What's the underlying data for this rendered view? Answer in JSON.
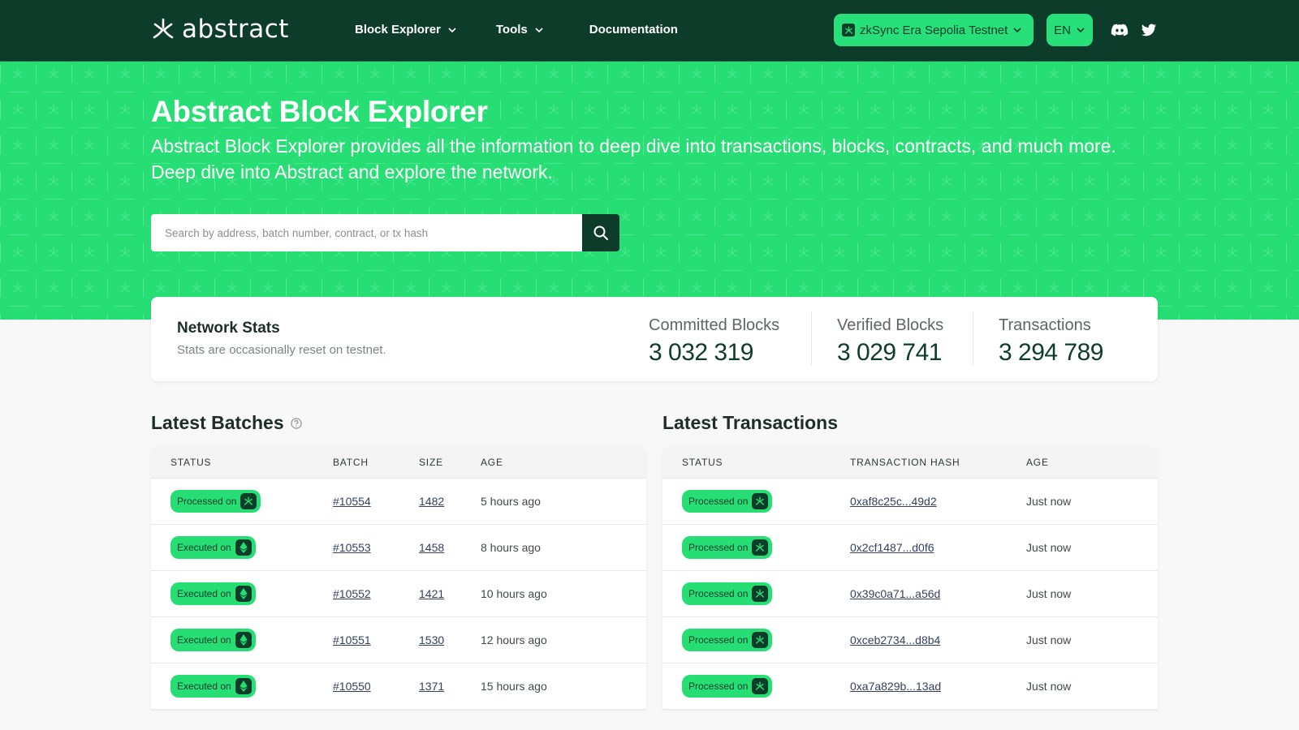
{
  "header": {
    "logo_text": "abstract",
    "nav": [
      {
        "label": "Block Explorer",
        "has_dropdown": true
      },
      {
        "label": "Tools",
        "has_dropdown": true
      },
      {
        "label": "Documentation",
        "has_dropdown": false
      }
    ],
    "network_selector": "zkSync Era Sepolia Testnet",
    "language_selector": "EN",
    "social_icons": [
      "discord-icon",
      "twitter-icon"
    ]
  },
  "hero": {
    "title": "Abstract Block Explorer",
    "description": "Abstract Block Explorer provides all the information to deep dive into transactions, blocks, contracts, and much more. Deep dive into Abstract and explore the network.",
    "search": {
      "placeholder": "Search by address, batch number, contract, or tx hash",
      "value": ""
    }
  },
  "stats": {
    "title": "Network Stats",
    "subtitle": "Stats are occasionally reset on testnet.",
    "items": [
      {
        "label": "Committed Blocks",
        "value": "3 032 319"
      },
      {
        "label": "Verified Blocks",
        "value": "3 029 741"
      },
      {
        "label": "Transactions",
        "value": "3 294 789"
      }
    ]
  },
  "batches": {
    "title": "Latest Batches",
    "columns": [
      "STATUS",
      "BATCH",
      "SIZE",
      "AGE"
    ],
    "rows": [
      {
        "status": "Processed on",
        "network": "abstract",
        "batch": "#10554",
        "size": "1482",
        "age": "5 hours ago"
      },
      {
        "status": "Executed on",
        "network": "ethereum",
        "batch": "#10553",
        "size": "1458",
        "age": "8 hours ago"
      },
      {
        "status": "Executed on",
        "network": "ethereum",
        "batch": "#10552",
        "size": "1421",
        "age": "10 hours ago"
      },
      {
        "status": "Executed on",
        "network": "ethereum",
        "batch": "#10551",
        "size": "1530",
        "age": "12 hours ago"
      },
      {
        "status": "Executed on",
        "network": "ethereum",
        "batch": "#10550",
        "size": "1371",
        "age": "15 hours ago"
      }
    ]
  },
  "transactions": {
    "title": "Latest Transactions",
    "columns": [
      "STATUS",
      "TRANSACTION HASH",
      "AGE"
    ],
    "rows": [
      {
        "status": "Processed on",
        "network": "abstract",
        "hash": "0xaf8c25c...49d2",
        "age": "Just now"
      },
      {
        "status": "Processed on",
        "network": "abstract",
        "hash": "0x2cf1487...d0f6",
        "age": "Just now"
      },
      {
        "status": "Processed on",
        "network": "abstract",
        "hash": "0x39c0a71...a56d",
        "age": "Just now"
      },
      {
        "status": "Processed on",
        "network": "abstract",
        "hash": "0xceb2734...d8b4",
        "age": "Just now"
      },
      {
        "status": "Processed on",
        "network": "abstract",
        "hash": "0xa7a829b...13ad",
        "age": "Just now"
      }
    ]
  },
  "colors": {
    "header_bg": "#0e3c2a",
    "accent_green": "#27de75",
    "link": "#34405e"
  }
}
